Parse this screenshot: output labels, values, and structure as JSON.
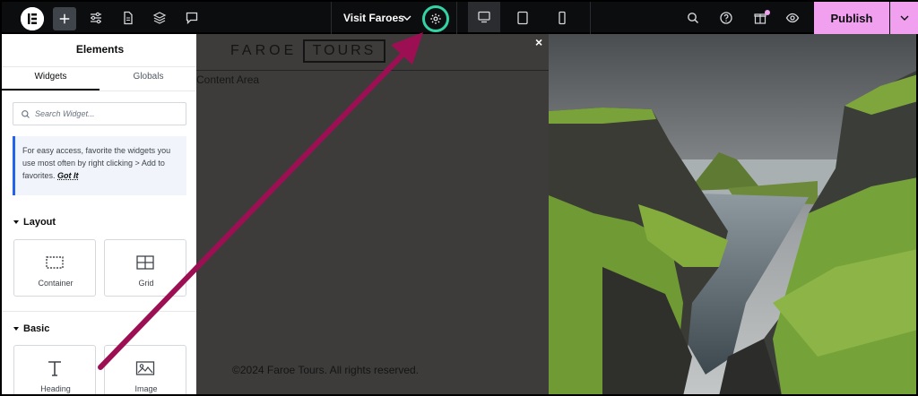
{
  "topbar": {
    "logo_icon": "elementor-logo-icon",
    "page_title": "Visit Faroes",
    "publish_label": "Publish",
    "accent_color": "#33d3a6",
    "publish_color": "#f1a0f0"
  },
  "panel": {
    "title": "Elements",
    "tabs": [
      {
        "label": "Widgets",
        "active": true
      },
      {
        "label": "Globals",
        "active": false
      }
    ],
    "search_placeholder": "Search Widget...",
    "tip_text": "For easy access, favorite the widgets you use most often by right clicking > Add to favorites.",
    "tip_link": "Got It",
    "sections": [
      {
        "title": "Layout",
        "widgets": [
          {
            "label": "Container",
            "icon": "container-icon"
          },
          {
            "label": "Grid",
            "icon": "grid-icon"
          }
        ]
      },
      {
        "title": "Basic",
        "widgets": [
          {
            "label": "Heading",
            "icon": "heading-icon"
          },
          {
            "label": "Image",
            "icon": "image-icon"
          }
        ]
      }
    ]
  },
  "canvas": {
    "site_name_a": "FAROE",
    "site_name_b": "TOURS",
    "content_area": "Content Area",
    "footer": "©2024 Faroe Tours. All rights reserved.",
    "close_label": "×"
  }
}
